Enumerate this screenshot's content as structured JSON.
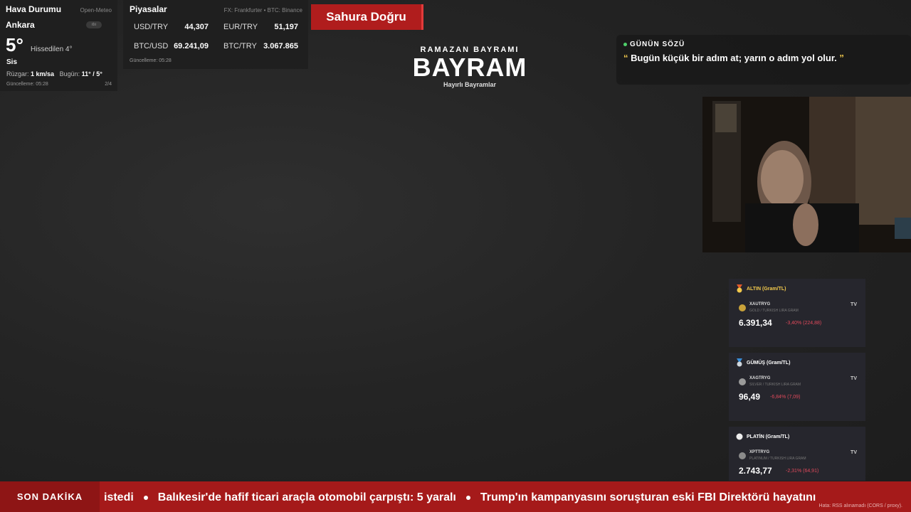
{
  "weather": {
    "title": "Hava Durumu",
    "source": "Open-Meteo",
    "city": "Ankara",
    "badge": "ıtıı",
    "temperature": "5°",
    "feels_like": "Hissedilen 4°",
    "condition": "Sis",
    "wind_label": "Rüzgar:",
    "wind_value": "1 km/sa",
    "today_label": "Bugün:",
    "today_value": "11° / 5°",
    "updated": "Güncelleme: 05:28",
    "page": "2/4"
  },
  "markets": {
    "title": "Piyasalar",
    "source": "FX: Frankfurter • BTC: Binance",
    "items": [
      {
        "label": "USD/TRY",
        "value": "44,307"
      },
      {
        "label": "EUR/TRY",
        "value": "51,197"
      },
      {
        "label": "BTC/USD",
        "value": "69.241,09"
      },
      {
        "label": "BTC/TRY",
        "value": "3.067.865"
      }
    ],
    "updated": "Güncelleme: 05:28"
  },
  "sahur": {
    "label": "Sahura Doğru"
  },
  "bayram": {
    "supertitle": "RAMAZAN BAYRAMI",
    "title": "BAYRAM",
    "subtitle": "Hayırlı Bayramlar"
  },
  "quote": {
    "heading": "GÜNÜN SÖZÜ",
    "open_mark": "“",
    "text": "Bugün küçük bir adım at; yarın o adım yol olur.",
    "close_mark": "”"
  },
  "metals": [
    {
      "title": "ALTIN (Gram/TL)",
      "symbol": "XAUTRYG",
      "description": "GOLD / TURKISH LIRA GRAM",
      "price": "6.391,34",
      "change": "-3,40% (224,88)",
      "title_color": "#f2c94c",
      "coin_color": "#c9a23a",
      "icon": "gold-medal-icon"
    },
    {
      "title": "GÜMÜŞ (Gram/TL)",
      "symbol": "XAGTRYG",
      "description": "SILVER / TURKISH LIRA GRAM",
      "price": "96,49",
      "change": "-6,84% (7,09)",
      "title_color": "#ffffff",
      "coin_color": "#9a9a9a",
      "icon": "silver-medal-icon"
    },
    {
      "title": "PLATİN (Gram/TL)",
      "symbol": "XPTTRYG",
      "description": "PLATINUM / TURKISH LIRA GRAM",
      "price": "2.743,77",
      "change": "-2,31% (64,91)",
      "title_color": "#ffffff",
      "coin_color": "#8a8a8a",
      "icon": "platinum-circle-icon"
    }
  ],
  "ticker": {
    "label": "SON DAKİKA",
    "items": [
      "istedi",
      "Balıkesir'de hafif ticari araçla otomobil çarpıştı: 5 yaralı",
      "Trump'ın kampanyasını soruşturan eski FBI Direktörü hayatını"
    ],
    "error": "Hata: RSS alınamadı (CORS / proxy)."
  },
  "colors": {
    "ticker_red": "#a51a1a",
    "sahur_red": "#b01d1d",
    "negative": "#e0495b"
  }
}
